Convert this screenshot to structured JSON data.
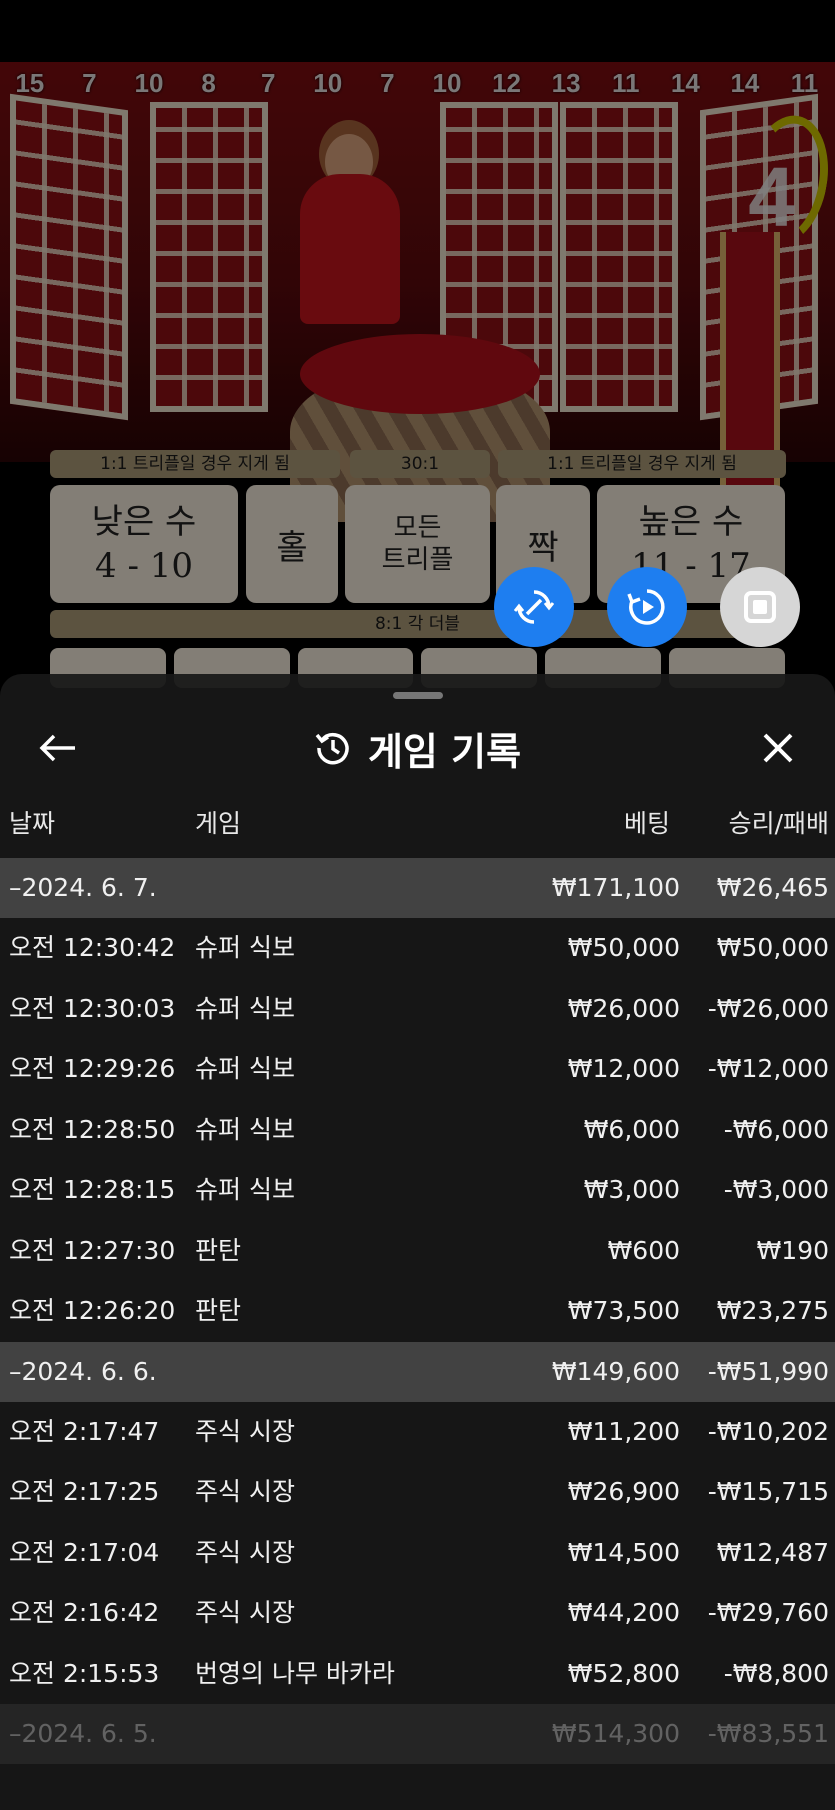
{
  "background_game": {
    "dice_history": [
      "15",
      "7",
      "10",
      "8",
      "7",
      "10",
      "7",
      "10",
      "12",
      "13",
      "11",
      "14",
      "14",
      "11"
    ],
    "round_timer": "4",
    "strips": {
      "left": "1:1 트리플일 경우 지게 됨",
      "mid": "30:1",
      "right": "1:1 트리플일 경우 지게 됨",
      "double": "8:1 각 더블"
    },
    "bets": {
      "small_label": "낮은 수",
      "small_range": "4 - 10",
      "odd": "홀",
      "any_triple_line1": "모든",
      "any_triple_line2": "트리플",
      "even": "짝",
      "big_label": "높은 수",
      "big_range": "11 - 17"
    },
    "buttons": {
      "autoplay_icon": "autoplay-icon",
      "replay_icon": "replay-icon",
      "stop_icon": "stop-icon"
    },
    "colors": {
      "accent_blue": "#1e7ef0",
      "board_cream": "#efe6d8",
      "felt_red": "#b0101a"
    }
  },
  "panel": {
    "title": "게임 기록",
    "title_icon": "history-icon",
    "back_icon": "back-arrow-icon",
    "close_icon": "close-icon",
    "columns": {
      "date": "날짜",
      "game": "게임",
      "bet": "베팅",
      "result": "승리/패배"
    },
    "groups": [
      {
        "date": "–2024. 6. 7.",
        "bet": "₩171,100",
        "result": "₩26,465",
        "rows": [
          {
            "time": "오전 12:30:42",
            "game": "슈퍼 식보",
            "bet": "₩50,000",
            "result": "₩50,000"
          },
          {
            "time": "오전 12:30:03",
            "game": "슈퍼 식보",
            "bet": "₩26,000",
            "result": "-₩26,000"
          },
          {
            "time": "오전 12:29:26",
            "game": "슈퍼 식보",
            "bet": "₩12,000",
            "result": "-₩12,000"
          },
          {
            "time": "오전 12:28:50",
            "game": "슈퍼 식보",
            "bet": "₩6,000",
            "result": "-₩6,000"
          },
          {
            "time": "오전 12:28:15",
            "game": "슈퍼 식보",
            "bet": "₩3,000",
            "result": "-₩3,000"
          },
          {
            "time": "오전 12:27:30",
            "game": "판탄",
            "bet": "₩600",
            "result": "₩190"
          },
          {
            "time": "오전 12:26:20",
            "game": "판탄",
            "bet": "₩73,500",
            "result": "₩23,275"
          }
        ]
      },
      {
        "date": "–2024. 6. 6.",
        "bet": "₩149,600",
        "result": "-₩51,990",
        "rows": [
          {
            "time": "오전 2:17:47",
            "game": "주식 시장",
            "bet": "₩11,200",
            "result": "-₩10,202"
          },
          {
            "time": "오전 2:17:25",
            "game": "주식 시장",
            "bet": "₩26,900",
            "result": "-₩15,715"
          },
          {
            "time": "오전 2:17:04",
            "game": "주식 시장",
            "bet": "₩14,500",
            "result": "₩12,487"
          },
          {
            "time": "오전 2:16:42",
            "game": "주식 시장",
            "bet": "₩44,200",
            "result": "-₩29,760"
          },
          {
            "time": "오전 2:15:53",
            "game": "번영의 나무 바카라",
            "bet": "₩52,800",
            "result": "-₩8,800"
          }
        ]
      },
      {
        "date": "–2024. 6. 5.",
        "bet": "₩514,300",
        "result": "-₩83,551",
        "rows": []
      }
    ]
  }
}
